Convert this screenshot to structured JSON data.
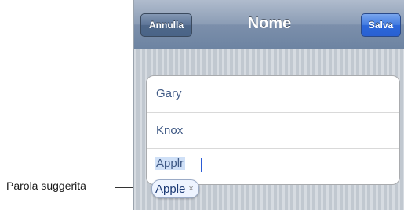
{
  "callout": {
    "label": "Parola suggerita"
  },
  "navbar": {
    "title": "Nome",
    "cancel_label": "Annulla",
    "save_label": "Salva"
  },
  "fields": [
    {
      "value": "Gary"
    },
    {
      "value": "Knox"
    },
    {
      "value": "Applr"
    }
  ],
  "suggestion": {
    "word": "Apple",
    "dismiss_glyph": "×"
  }
}
